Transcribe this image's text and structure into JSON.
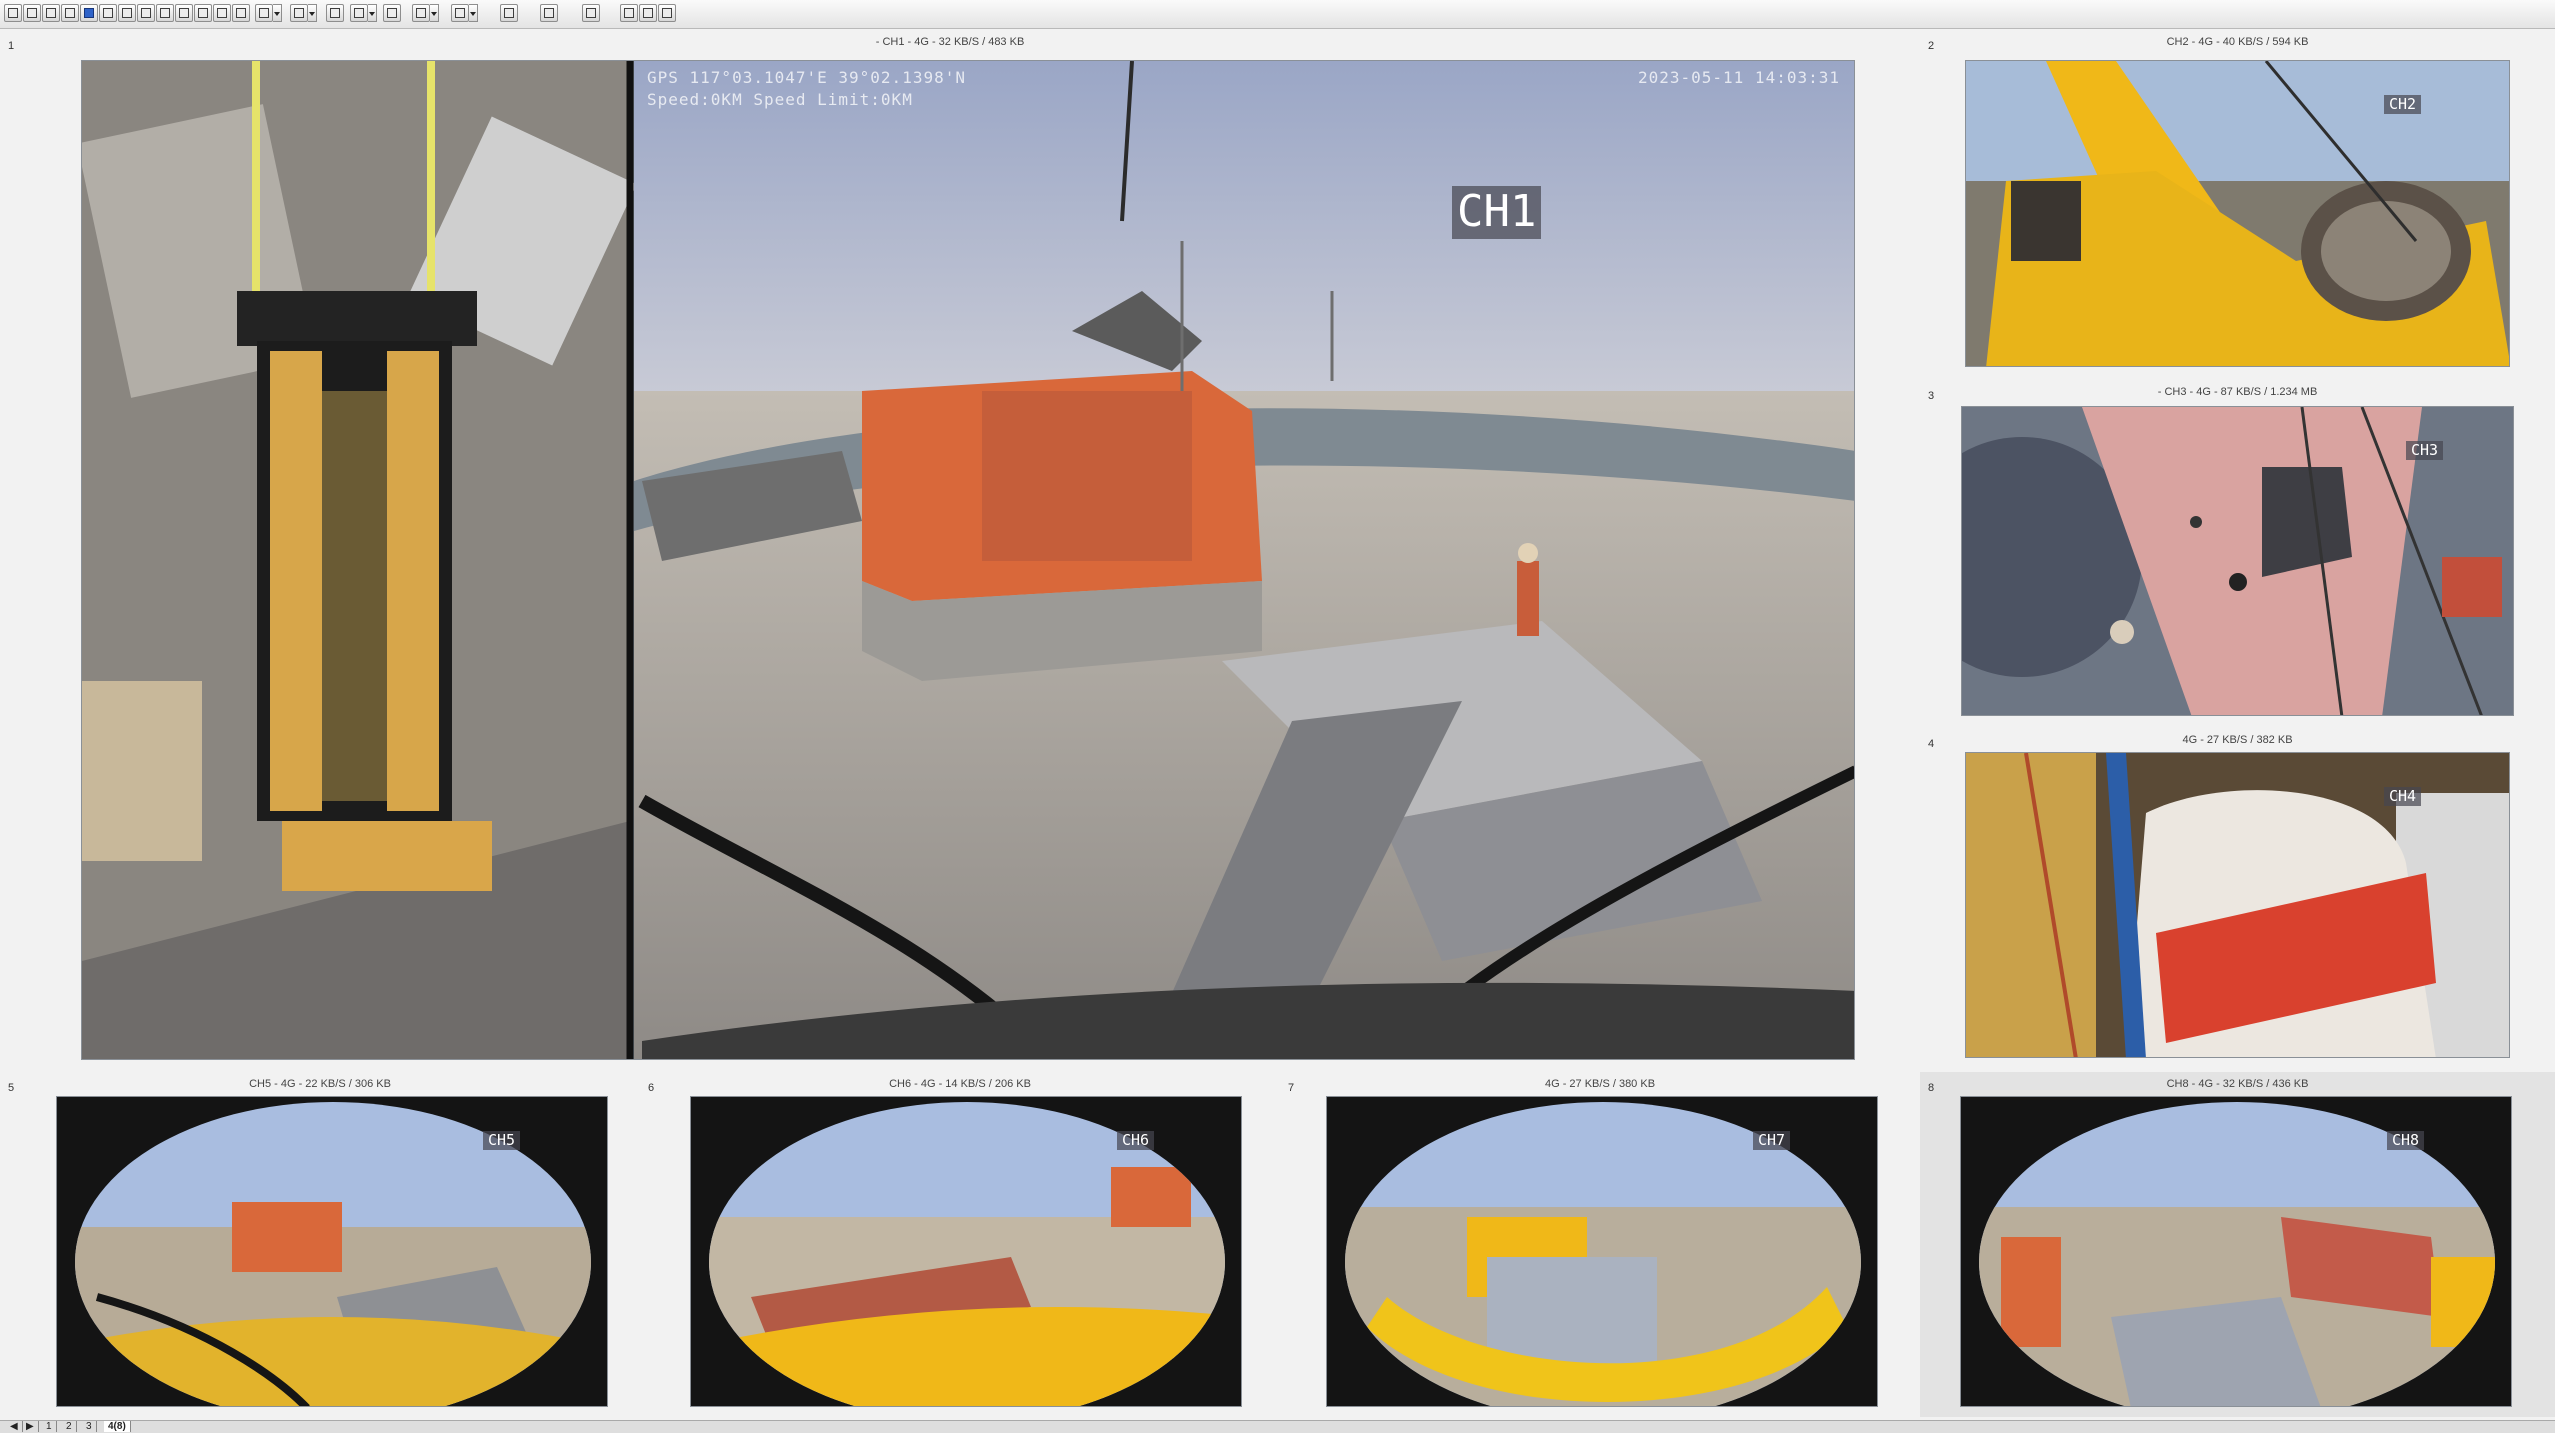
{
  "toolbar": {
    "icons": [
      "layout-1x1-icon",
      "layout-1x2-icon",
      "layout-2x2-icon",
      "layout-1plus7-icon",
      "layout-8-icon",
      "layout-3x3-icon",
      "layout-4x4-icon",
      "layout-custom-icon",
      "zoom-in-icon",
      "zoom-out-icon",
      "fullscreen-icon",
      "lock-icon",
      "window-icon",
      "snapshot-icon",
      "record-icon",
      "audio-icon",
      "play-icon",
      "stop-icon",
      "save-icon",
      "file-icon",
      "delete-icon",
      "settings-icon",
      "layout-icon",
      "expand-icon"
    ],
    "active_icon": "layout-1plus7-icon"
  },
  "panes": [
    {
      "index": "1",
      "caption": "- CH1 - 4G - 32 KB/S / 483 KB",
      "channel": "CH1",
      "osd_left_1": "GPS 117°03.1047'E  39°02.1398'N",
      "osd_left_2": "Speed:0KM  Speed Limit:0KM",
      "osd_right": "2023-05-11  14:03:31"
    },
    {
      "index": "2",
      "caption": "CH2 - 4G - 40 KB/S / 594 KB",
      "channel": "CH2"
    },
    {
      "index": "3",
      "caption": "- CH3 - 4G - 87 KB/S / 1.234 MB",
      "channel": "CH3"
    },
    {
      "index": "4",
      "caption": "4G - 27 KB/S / 382 KB",
      "channel": "CH4"
    },
    {
      "index": "5",
      "caption": "CH5 - 4G - 22 KB/S / 306 KB",
      "channel": "CH5"
    },
    {
      "index": "6",
      "caption": "CH6 - 4G - 14 KB/S / 206 KB",
      "channel": "CH6"
    },
    {
      "index": "7",
      "caption": "4G - 27 KB/S / 380 KB",
      "channel": "CH7"
    },
    {
      "index": "8",
      "caption": "CH8 - 4G - 32 KB/S / 436 KB",
      "channel": "CH8"
    }
  ],
  "tabs": [
    {
      "label": "1"
    },
    {
      "label": "2"
    },
    {
      "label": "3"
    },
    {
      "label": "4(8)",
      "active": true
    }
  ],
  "colors": {
    "accent": "#2f63c9",
    "machine_orange": "#d9683a",
    "crane_yellow": "#f0b818",
    "sky": "#a7b9d6"
  }
}
